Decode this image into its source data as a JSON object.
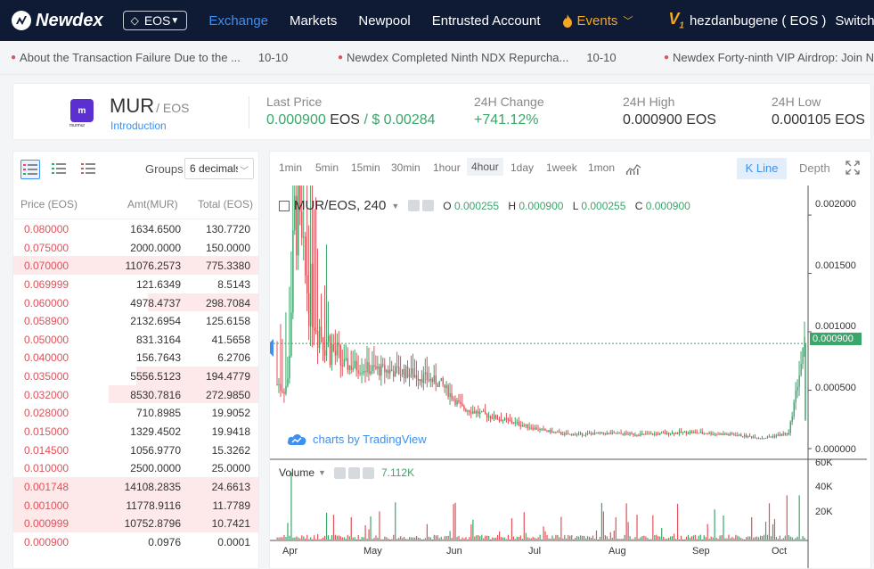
{
  "nav": {
    "logo_text": "Newdex",
    "chain_select": "EOS",
    "items": [
      {
        "label": "Exchange",
        "active": true
      },
      {
        "label": "Markets"
      },
      {
        "label": "Newpool"
      },
      {
        "label": "Entrusted Account"
      }
    ],
    "events_label": "Events",
    "user_name": "hezdanbugene ( EOS )",
    "switch_label": "Switch",
    "cut_label": "E"
  },
  "ticker": [
    {
      "text": "About the Transaction Failure Due to the ...",
      "date": "10-10"
    },
    {
      "text": "Newdex Completed Ninth NDX Repurcha...",
      "date": "10-10"
    },
    {
      "text": "Newdex Forty-ninth VIP Airdrop: Join N",
      "date": ""
    }
  ],
  "summary": {
    "logo_caption": "murmur",
    "base": "MUR",
    "quote": "/ EOS",
    "intro": "Introduction",
    "last_price_label": "Last Price",
    "last_price": "0.000900",
    "last_price_unit": "EOS",
    "last_price_usd": "/ $ 0.00284",
    "change_label": "24H Change",
    "change": "+741.12%",
    "high_label": "24H High",
    "high": "0.000900",
    "high_unit": "EOS",
    "low_label": "24H Low",
    "low": "0.000105",
    "low_unit": "EOS"
  },
  "orderbook": {
    "groups_label": "Groups",
    "groups_value": "6 decimals",
    "col_price": "Price (EOS)",
    "col_amount": "Amt(MUR)",
    "col_total": "Total (EOS)",
    "rows": [
      {
        "price": "0.080000",
        "amount": "1634.6500",
        "total": "130.7720",
        "depth": 0
      },
      {
        "price": "0.075000",
        "amount": "2000.0000",
        "total": "150.0000",
        "depth": 0
      },
      {
        "price": "0.070000",
        "amount": "11076.2573",
        "total": "775.3380",
        "depth": 1.0
      },
      {
        "price": "0.069999",
        "amount": "121.6349",
        "total": "8.5143",
        "depth": 0
      },
      {
        "price": "0.060000",
        "amount": "4978.4737",
        "total": "298.7084",
        "depth": 0.45
      },
      {
        "price": "0.058900",
        "amount": "2132.6954",
        "total": "125.6158",
        "depth": 0
      },
      {
        "price": "0.050000",
        "amount": "831.3164",
        "total": "41.5658",
        "depth": 0
      },
      {
        "price": "0.040000",
        "amount": "156.7643",
        "total": "6.2706",
        "depth": 0
      },
      {
        "price": "0.035000",
        "amount": "5556.5123",
        "total": "194.4779",
        "depth": 0.5
      },
      {
        "price": "0.032000",
        "amount": "8530.7816",
        "total": "272.9850",
        "depth": 0.61
      },
      {
        "price": "0.028000",
        "amount": "710.8985",
        "total": "19.9052",
        "depth": 0
      },
      {
        "price": "0.015000",
        "amount": "1329.4502",
        "total": "19.9418",
        "depth": 0
      },
      {
        "price": "0.014500",
        "amount": "1056.9770",
        "total": "15.3262",
        "depth": 0
      },
      {
        "price": "0.010000",
        "amount": "2500.0000",
        "total": "25.0000",
        "depth": 0
      },
      {
        "price": "0.001748",
        "amount": "14108.2835",
        "total": "24.6613",
        "depth": 1.0
      },
      {
        "price": "0.001000",
        "amount": "11778.9116",
        "total": "11.7789",
        "depth": 1.0
      },
      {
        "price": "0.000999",
        "amount": "10752.8796",
        "total": "10.7421",
        "depth": 1.0
      },
      {
        "price": "0.000900",
        "amount": "0.0976",
        "total": "0.0001",
        "depth": 0
      }
    ]
  },
  "chart_panel": {
    "timeframes": [
      "1min",
      "5min",
      "15min",
      "30min",
      "1hour",
      "4hour",
      "1day",
      "1week",
      "1mon"
    ],
    "active_timeframe": "4hour",
    "kline_label": "K Line",
    "depth_label": "Depth",
    "title": "MUR/EOS, 240",
    "ohlc": {
      "o": "0.000255",
      "h": "0.000900",
      "l": "0.000255",
      "c": "0.000900"
    },
    "watermark": "charts by TradingView",
    "volume_label": "Volume",
    "volume_value": "7.112K",
    "last_price_tag": "0.000900",
    "price_ticks": [
      "0.002000",
      "0.001500",
      "0.001000",
      "0.000500",
      "0.000000"
    ],
    "volume_ticks": [
      "60K",
      "40K",
      "20K"
    ],
    "month_ticks": [
      "Apr",
      "May",
      "Jun",
      "Jul",
      "Aug",
      "Sep",
      "Oct"
    ]
  },
  "colors": {
    "up": "#3aa66a",
    "down": "#e0525a",
    "accent": "#3d8ff0",
    "nav_bg": "#0f1a35",
    "events": "#f5a623"
  },
  "icons": [
    "eos-diamond-icon",
    "fire-icon",
    "chevron-down-icon",
    "v1-badge-icon",
    "orderbook-both-icon",
    "orderbook-buy-icon",
    "orderbook-sell-icon",
    "indicators-icon",
    "fullscreen-icon",
    "settings-icon",
    "eye-icon",
    "tradingview-cloud-icon"
  ],
  "chart_data": {
    "type": "candlestick",
    "series_name": "MUR/EOS",
    "interval": "240",
    "x_ticks": [
      "Apr",
      "May",
      "Jun",
      "Jul",
      "Aug",
      "Sep",
      "Oct"
    ],
    "y_ticks": [
      "0.000000",
      "0.000500",
      "0.001000",
      "0.001500",
      "0.002000"
    ],
    "ylim": [
      0,
      0.0021
    ],
    "price_path": [
      [
        0.02,
        0.00055
      ],
      [
        0.035,
        0.0021
      ],
      [
        0.05,
        0.0015
      ],
      [
        0.08,
        0.00105
      ],
      [
        0.12,
        0.00072
      ],
      [
        0.18,
        0.00068
      ],
      [
        0.25,
        0.00065
      ],
      [
        0.31,
        0.00056
      ],
      [
        0.35,
        0.00035
      ],
      [
        0.4,
        0.00028
      ],
      [
        0.45,
        0.00022
      ],
      [
        0.5,
        0.00016
      ],
      [
        0.55,
        0.00012
      ],
      [
        0.62,
        0.00013
      ],
      [
        0.7,
        0.00012
      ],
      [
        0.78,
        0.00014
      ],
      [
        0.86,
        0.00012
      ],
      [
        0.92,
        9e-05
      ],
      [
        0.97,
        0.00013
      ],
      [
        1.0,
        0.0009
      ]
    ],
    "volume_max": 68000,
    "last_price": 0.0009
  }
}
